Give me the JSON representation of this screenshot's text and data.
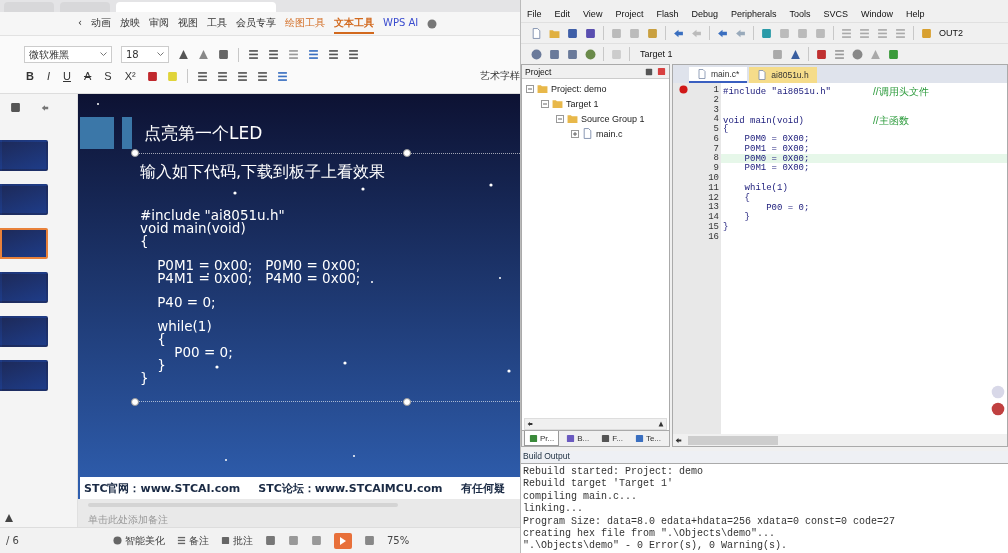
{
  "wps": {
    "menu": [
      {
        "label": "‹",
        "kind": "tab",
        "selected": false
      },
      {
        "label": "动画",
        "kind": "tab",
        "selected": false
      },
      {
        "label": "放映",
        "kind": "tab",
        "selected": false
      },
      {
        "label": "审阅",
        "kind": "tab",
        "selected": false
      },
      {
        "label": "视图",
        "kind": "tab",
        "selected": false
      },
      {
        "label": "工具",
        "kind": "tab",
        "selected": false
      },
      {
        "label": "会员专享",
        "kind": "tab",
        "selected": false
      },
      {
        "label": "绘图工具",
        "kind": "context",
        "selected": false
      },
      {
        "label": "文本工具",
        "kind": "context",
        "selected": true
      },
      {
        "label": "WPS AI",
        "kind": "ai",
        "selected": false
      }
    ],
    "ribbon": {
      "font": "微软雅黑",
      "size": "18",
      "format_buttons": [
        "B",
        "I",
        "U",
        "A",
        "S",
        "X²"
      ],
      "wordart": "艺术字样"
    },
    "thumbnails": [
      {
        "selected": false
      },
      {
        "selected": false
      },
      {
        "selected": true
      },
      {
        "selected": false
      },
      {
        "selected": false
      },
      {
        "selected": false
      }
    ],
    "slide": {
      "title": "点亮第一个LED",
      "subtitle": "输入如下代码,下载到板子上看效果",
      "code": [
        [
          "#include \"ai8051u.h\"",
          "void main(void)",
          "{"
        ],
        [
          "    P0M1 = 0x00;   P0M0 = 0x00;",
          "    P4M1 = 0x00;   P4M0 = 0x00;"
        ],
        [
          "    P40 = 0;"
        ],
        [
          "    while(1)",
          "    {",
          "        P00 = 0;",
          "    }",
          "}"
        ]
      ],
      "footer": [
        "STC官网：www.STCAI.com",
        "STC论坛：www.STCAIMCU.com",
        "有任何疑"
      ]
    },
    "notes_placeholder": "单击此处添加备注",
    "status": {
      "page": "/ 6",
      "beautify": "智能美化",
      "notes": "备注",
      "comments": "批注",
      "zoom": "75%"
    }
  },
  "keil": {
    "menu": [
      "File",
      "Edit",
      "View",
      "Project",
      "Flash",
      "Debug",
      "Peripherals",
      "Tools",
      "SVCS",
      "Window",
      "Help"
    ],
    "output_window": "OUT2",
    "target": "Target 1",
    "project_title": "Project",
    "tree": [
      {
        "label": "Project: demo",
        "expanded": true,
        "children": [
          {
            "label": "Target 1",
            "expanded": true,
            "children": [
              {
                "label": "Source Group 1",
                "expanded": true,
                "children": [
                  {
                    "label": "main.c",
                    "expanded": false
                  }
                ]
              }
            ]
          }
        ]
      }
    ],
    "panel_tabs": [
      {
        "label": "Pr...",
        "selected": true
      },
      {
        "label": "B...",
        "selected": false
      },
      {
        "label": "F...",
        "selected": false
      },
      {
        "label": "Te...",
        "selected": false
      }
    ],
    "editor_tabs": [
      {
        "label": "main.c*",
        "selected": true
      },
      {
        "label": "ai8051u.h",
        "selected": false
      }
    ],
    "lines": [
      {
        "num": "1",
        "code": "#include \"ai8051u.h\"",
        "comment": "//调用头文件",
        "breakpoint": true,
        "highlighted": false
      },
      {
        "num": "2",
        "breakpoint": false,
        "highlighted": false
      },
      {
        "num": "3",
        "breakpoint": false,
        "highlighted": false
      },
      {
        "num": "4",
        "code": "void main(void)",
        "comment": "//主函数",
        "breakpoint": false,
        "highlighted": false
      },
      {
        "num": "5",
        "code": "{",
        "breakpoint": false,
        "highlighted": false
      },
      {
        "num": "6",
        "code": "    P0M0 = 0X00;",
        "breakpoint": false,
        "highlighted": false
      },
      {
        "num": "7",
        "code": "    P0M1 = 0X00;",
        "breakpoint": false,
        "highlighted": false
      },
      {
        "num": "8",
        "code": "    P0M0 = 0X00;",
        "breakpoint": false,
        "highlighted": true
      },
      {
        "num": "9",
        "code": "    P0M1 = 0X00;",
        "breakpoint": false,
        "highlighted": false
      },
      {
        "num": "10",
        "breakpoint": false,
        "highlighted": false
      },
      {
        "num": "11",
        "code": "    while(1)",
        "breakpoint": false,
        "highlighted": false
      },
      {
        "num": "12",
        "code": "    {",
        "breakpoint": false,
        "highlighted": false
      },
      {
        "num": "13",
        "code": "        P00 = 0;",
        "breakpoint": false,
        "highlighted": false
      },
      {
        "num": "14",
        "code": "    }",
        "breakpoint": false,
        "highlighted": false
      },
      {
        "num": "15",
        "code": "}",
        "breakpoint": false,
        "highlighted": false
      },
      {
        "num": "16",
        "breakpoint": false,
        "highlighted": false
      }
    ],
    "build_title": "Build Output",
    "build_lines": [
      "Rebuild started: Project: demo",
      "Rebuild target 'Target 1'",
      "compiling main.c...",
      "linking...",
      "Program Size: data=8.0 edata+hdata=256 xdata=0 const=0 code=27",
      "creating hex file from \".\\Objects\\demo\"...",
      "\".\\Objects\\demo\" - 0 Error(s), 0 Warning(s)."
    ]
  }
}
